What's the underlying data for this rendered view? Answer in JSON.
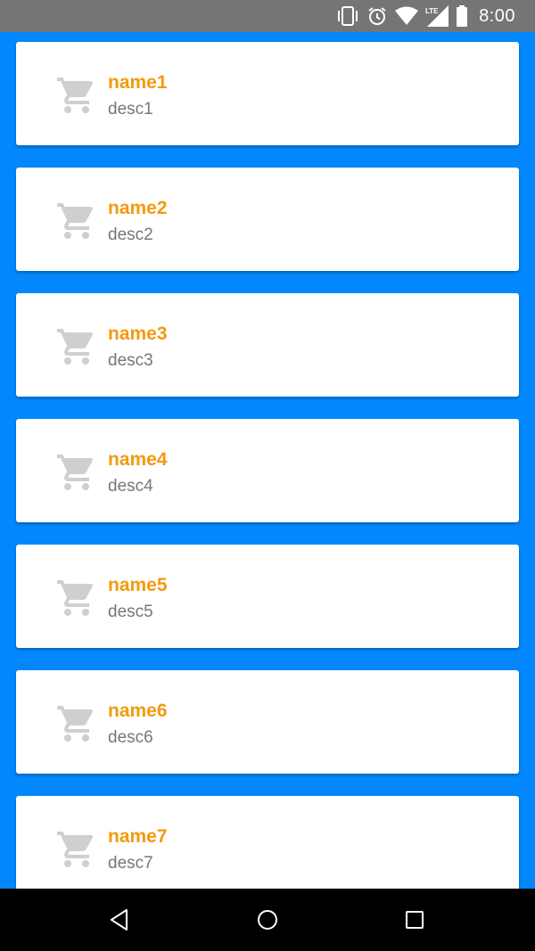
{
  "status_bar": {
    "time": "8:00",
    "icons": [
      "vibrate-icon",
      "alarm-icon",
      "wifi-icon",
      "lte-signal-icon",
      "battery-icon"
    ],
    "lte_label": "LTE"
  },
  "colors": {
    "background": "#0288fc",
    "status_bar": "#767576",
    "name_text": "#f39a0e",
    "desc_text": "#777777",
    "icon": "#cfcfcf"
  },
  "items": [
    {
      "name": "name1",
      "desc": "desc1",
      "icon": "cart-icon"
    },
    {
      "name": "name2",
      "desc": "desc2",
      "icon": "cart-icon"
    },
    {
      "name": "name3",
      "desc": "desc3",
      "icon": "cart-icon"
    },
    {
      "name": "name4",
      "desc": "desc4",
      "icon": "cart-icon"
    },
    {
      "name": "name5",
      "desc": "desc5",
      "icon": "cart-icon"
    },
    {
      "name": "name6",
      "desc": "desc6",
      "icon": "cart-icon"
    },
    {
      "name": "name7",
      "desc": "desc7",
      "icon": "cart-icon"
    }
  ],
  "nav_bar": {
    "buttons": [
      "back-icon",
      "home-icon",
      "recents-icon"
    ]
  }
}
